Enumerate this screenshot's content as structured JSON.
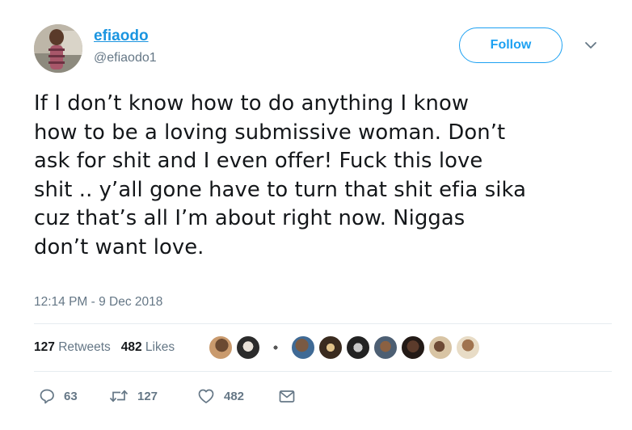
{
  "user": {
    "display_name": "efiaodo",
    "handle": "@efiaodo1"
  },
  "follow_label": "Follow",
  "tweet": {
    "lines": [
      "If I don’t know how to do anything I know",
      "how to be a loving submissive woman. Don’t",
      "ask for shit and I even offer! Fuck this love",
      "shit .. y’all gone have to turn that shit efia sika",
      "cuz that’s all I’m about right now. Niggas",
      "don’t want love."
    ],
    "timestamp": "12:14 PM - 9 Dec 2018"
  },
  "stats": {
    "retweets_count": "127",
    "retweets_label": "Retweets",
    "likes_count": "482",
    "likes_label": "Likes"
  },
  "actions": {
    "reply_count": "63",
    "retweet_count": "127",
    "like_count": "482"
  },
  "colors": {
    "accent": "#1da1f2",
    "link": "#1b95e0",
    "muted": "#657786",
    "divider": "#e6ecf0"
  },
  "icons": [
    "chevron-down-icon",
    "reply-icon",
    "retweet-icon",
    "heart-icon",
    "message-icon"
  ]
}
